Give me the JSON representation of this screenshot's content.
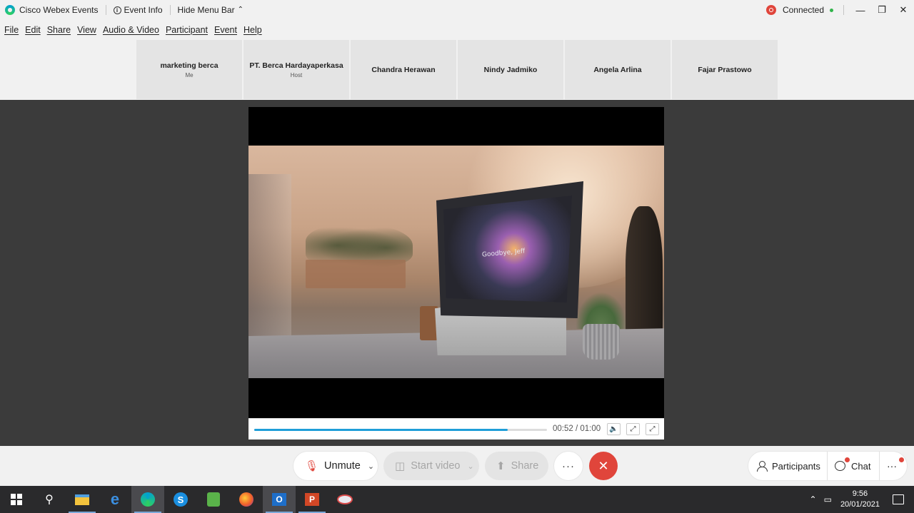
{
  "titlebar": {
    "app_name": "Cisco Webex Events",
    "event_info": "Event Info",
    "hide_menu": "Hide Menu Bar",
    "status": "Connected"
  },
  "menu": [
    "File",
    "Edit",
    "Share",
    "View",
    "Audio & Video",
    "Participant",
    "Event",
    "Help"
  ],
  "participants": [
    {
      "name": "marketing berca",
      "role": "Me"
    },
    {
      "name": "PT. Berca Hardayaperkasa",
      "role": "Host"
    },
    {
      "name": "Chandra Herawan",
      "role": ""
    },
    {
      "name": "Nindy Jadmiko",
      "role": ""
    },
    {
      "name": "Angela Arlina",
      "role": ""
    },
    {
      "name": "Fajar Prastowo",
      "role": ""
    }
  ],
  "video": {
    "screen_text": "Goodbye, Jeff",
    "time": "00:52 / 01:00",
    "progress": 0.867
  },
  "controls": {
    "unmute": "Unmute",
    "start_video": "Start video",
    "share": "Share",
    "participants": "Participants",
    "chat": "Chat"
  },
  "taskbar": {
    "time": "9:56",
    "date": "20/01/2021"
  },
  "colors": {
    "accent_blue": "#1f9ed8",
    "end_red": "#e0453b",
    "connected_green": "#30b44a"
  }
}
